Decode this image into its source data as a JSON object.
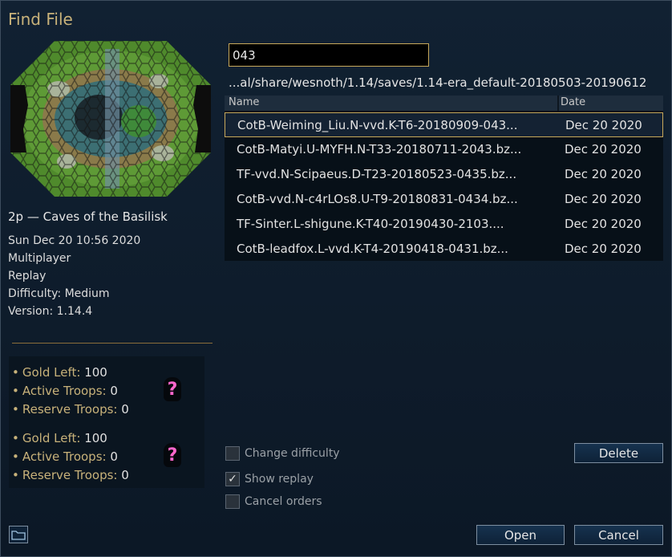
{
  "dialog": {
    "title": "Find File"
  },
  "preview": {
    "scenario_name": "2p — Caves of the Basilisk",
    "info": [
      "Sun Dec 20 10:56 2020",
      "Multiplayer",
      "Replay",
      "Difficulty: Medium",
      "Version: 1.14.4"
    ],
    "sides": [
      {
        "gold_label": "Gold Left:",
        "gold": "100",
        "troops_label": "Active Troops:",
        "troops": "0",
        "reserve_label": "Reserve Troops:",
        "reserve": "0",
        "unit_glyph": "?"
      },
      {
        "gold_label": "Gold Left:",
        "gold": "100",
        "troops_label": "Active Troops:",
        "troops": "0",
        "reserve_label": "Reserve Troops:",
        "reserve": "0",
        "unit_glyph": "?"
      }
    ]
  },
  "filter": {
    "value": "043"
  },
  "path": "...al/share/wesnoth/1.14/saves/1.14-era_default-20180503-20190612",
  "list": {
    "columns": {
      "name": "Name",
      "date": "Date"
    },
    "rows": [
      {
        "name": "CotB-Weiming_Liu.N-vvd.K-T6-20180909-043...",
        "date": "Dec 20 2020",
        "selected": true
      },
      {
        "name": "CotB-Matyi.U-MYFH.N-T33-20180711-2043.bz...",
        "date": "Dec 20 2020",
        "selected": false
      },
      {
        "name": "TF-vvd.N-Scipaeus.D-T23-20180523-0435.bz...",
        "date": "Dec 20 2020",
        "selected": false
      },
      {
        "name": "CotB-vvd.N-c4rLOs8.U-T9-20180831-0434.bz...",
        "date": "Dec 20 2020",
        "selected": false
      },
      {
        "name": "TF-Sinter.L-shigune.K-T40-20190430-2103....",
        "date": "Dec 20 2020",
        "selected": false
      },
      {
        "name": "CotB-leadfox.L-vvd.K-T4-20190418-0431.bz...",
        "date": "Dec 20 2020",
        "selected": false
      }
    ]
  },
  "options": {
    "change_difficulty": {
      "label": "Change difficulty",
      "checked": false
    },
    "show_replay": {
      "label": "Show replay",
      "checked": true
    },
    "cancel_orders": {
      "label": "Cancel orders",
      "checked": false
    }
  },
  "buttons": {
    "delete": "Delete",
    "open": "Open",
    "cancel": "Cancel"
  },
  "icons": {
    "folder": "folder-icon",
    "checkmark": "checkmark-icon"
  },
  "colors": {
    "accent_gold": "#c8b27a",
    "unknown_unit": "#ff66cc",
    "selection_border": "#c8a85a"
  }
}
